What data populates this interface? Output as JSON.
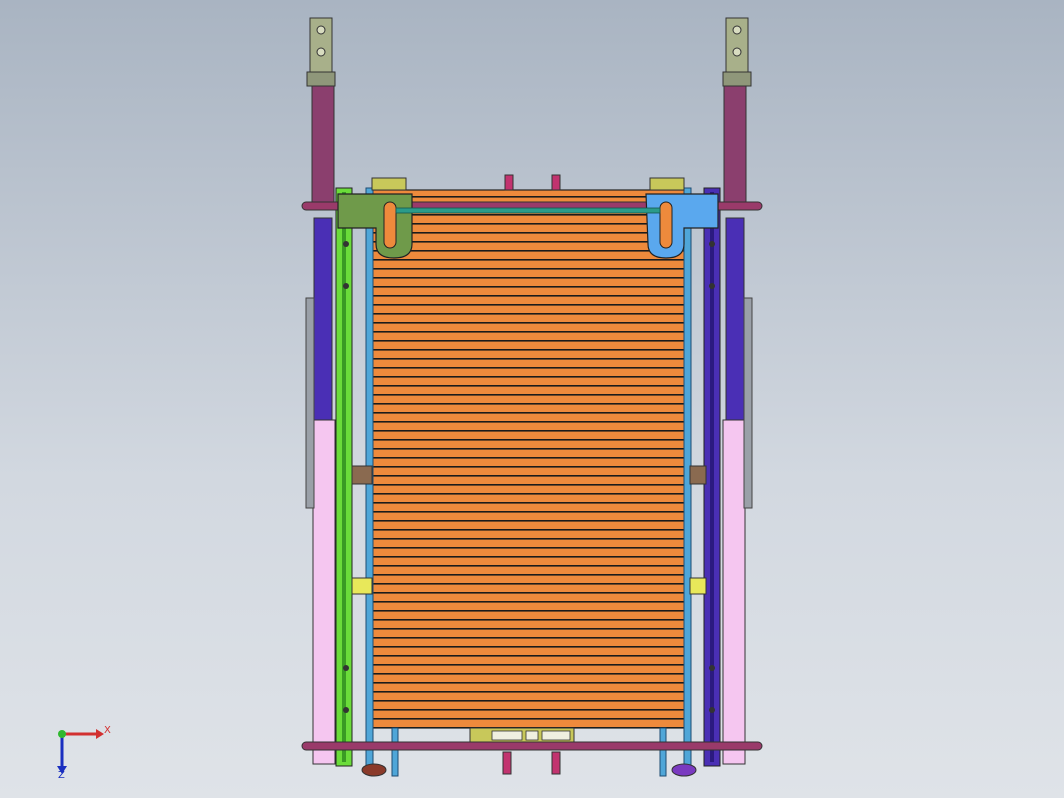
{
  "app": {
    "title": ""
  },
  "viewport": {
    "background_top": "#a9b4c2",
    "background_bottom": "#dfe3e8"
  },
  "model": {
    "colors": {
      "plate_orange": "#ee8a3c",
      "slat_dark": "#1b1b1b",
      "frame_green": "#6bdc3a",
      "frame_purple": "#4a2fb5",
      "post_maroon": "#8b3f6e",
      "post_pink": "#f5c6f0",
      "rod_blue": "#4fa6d8",
      "rod_magenta": "#9a3a6a",
      "bracket_green": "#6f9a4a",
      "bracket_blue": "#5aa8ee",
      "cable_teal": "#2a9b8a",
      "hinge_gray": "#a8b08a"
    }
  },
  "triad": {
    "x_label": "X",
    "z_label": "Z",
    "x_color": "#d23030",
    "z_color": "#1a2fc0",
    "origin_color": "#2fb82f"
  }
}
